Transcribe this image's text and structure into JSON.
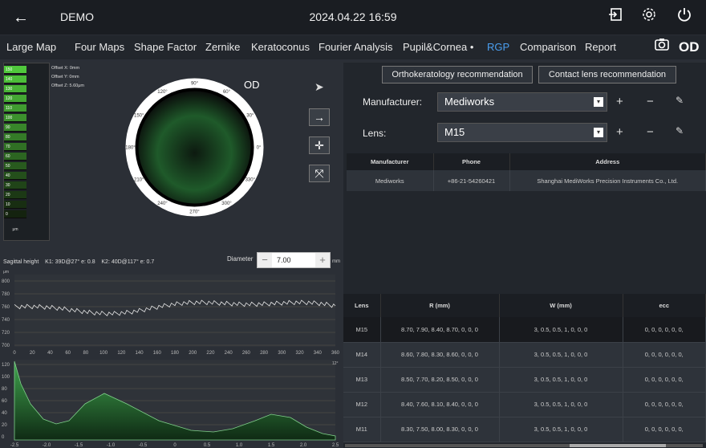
{
  "header": {
    "back": "←",
    "title": "DEMO",
    "datetime": "2024.04.22 16:59"
  },
  "tabs": [
    "Large Map",
    "Four Maps",
    "Shape Factor",
    "Zernike",
    "Keratoconus",
    "Fourier Analysis",
    "Pupil&Cornea •",
    "RGP",
    "Comparison",
    "Report"
  ],
  "active_tab": "RGP",
  "eye_label": "OD",
  "scale": {
    "values": [
      "150",
      "140",
      "130",
      "120",
      "110",
      "100",
      "90",
      "80",
      "70",
      "60",
      "50",
      "40",
      "30",
      "20",
      "10",
      "0"
    ],
    "unit": "μm"
  },
  "offsets": [
    "Offset X: 0mm",
    "Offset Y: 0mm",
    "Offset Z: 5.60μm"
  ],
  "map_eye": "OD",
  "angles": [
    "90°",
    "60°",
    "30°",
    "0°",
    "330°",
    "300°",
    "270°",
    "240°",
    "210°",
    "180°",
    "150°",
    "120°"
  ],
  "sagittal": {
    "title": "Sagittal height",
    "k1": "K1: 39D@27° e: 0.8",
    "k2": "K2: 40D@117° e: 0.7",
    "diameter_label": "Diameter",
    "diameter": "7.00",
    "unit": "mm"
  },
  "sag_chart": {
    "yunit": "μm",
    "yticks": [
      "800",
      "780",
      "760",
      "740",
      "720",
      "700"
    ],
    "xticks": [
      "0",
      "20",
      "40",
      "60",
      "80",
      "100",
      "120",
      "140",
      "160",
      "180",
      "200",
      "220",
      "240",
      "260",
      "280",
      "300",
      "320",
      "340",
      "360"
    ]
  },
  "profile_chart": {
    "yunit": "μm",
    "yticks": [
      "120",
      "100",
      "80",
      "60",
      "40",
      "20",
      "0"
    ],
    "xticks": [
      "-2.5",
      "-2.0",
      "-1.5",
      "-1.0",
      "-0.5",
      "0",
      "0.5",
      "1.0",
      "1.5",
      "2.0",
      "2.5"
    ],
    "right_label": "12°"
  },
  "right": {
    "btn_ortho": "Orthokeratology recommendation",
    "btn_contact": "Contact lens recommendation",
    "manufacturer_label": "Manufacturer:",
    "manufacturer": "Mediworks",
    "lens_label": "Lens:",
    "lens": "M15",
    "mtable_headers": [
      "Manufacturer",
      "Phone",
      "Address"
    ],
    "mtable_row": [
      "Mediworks",
      "+86-21-54260421",
      "Shanghai MediWorks Precision Instruments Co., Ltd."
    ],
    "ltable_headers": [
      "Lens",
      "R (mm)",
      "W (mm)",
      "ecc"
    ],
    "ltable_rows": [
      [
        "M15",
        "8.70, 7.90, 8.40, 8.70, 0, 0, 0",
        "3, 0.5, 0.5, 1, 0, 0, 0",
        "0, 0, 0, 0, 0, 0,"
      ],
      [
        "M14",
        "8.60, 7.80, 8.30, 8.60, 0, 0, 0",
        "3, 0.5, 0.5, 1, 0, 0, 0",
        "0, 0, 0, 0, 0, 0,"
      ],
      [
        "M13",
        "8.50, 7.70, 8.20, 8.50, 0, 0, 0",
        "3, 0.5, 0.5, 1, 0, 0, 0",
        "0, 0, 0, 0, 0, 0,"
      ],
      [
        "M12",
        "8.40, 7.60, 8.10, 8.40, 0, 0, 0",
        "3, 0.5, 0.5, 1, 0, 0, 0",
        "0, 0, 0, 0, 0, 0,"
      ],
      [
        "M11",
        "8.30, 7.50, 8.00, 8.30, 0, 0, 0",
        "3, 0.5, 0.5, 1, 0, 0, 0",
        "0, 0, 0, 0, 0, 0,"
      ]
    ]
  },
  "colors": {
    "accent": "#4a9ff0",
    "map_green": "#2f8a3a"
  }
}
